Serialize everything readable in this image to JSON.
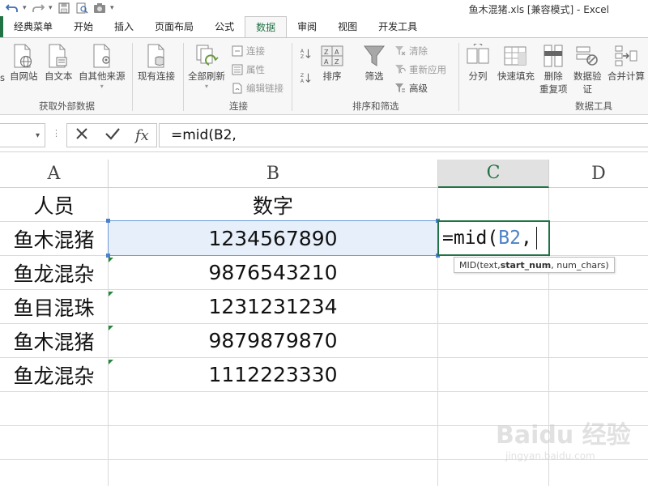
{
  "window": {
    "title": "鱼木混猪.xls  [兼容模式] - Excel"
  },
  "ribbon": {
    "tabs": [
      "经典菜单",
      "开始",
      "插入",
      "页面布局",
      "公式",
      "数据",
      "审阅",
      "视图",
      "开发工具"
    ],
    "active_tab": "数据",
    "groups": {
      "external": {
        "label": "获取外部数据",
        "cut_label": "s",
        "from_web": "自网站",
        "from_text": "自文本",
        "from_other": "自其他来源",
        "existing": "现有连接"
      },
      "connections": {
        "label": "连接",
        "refresh_all": "全部刷新",
        "connections": "连接",
        "properties": "属性",
        "edit_links": "编辑链接"
      },
      "sort_filter": {
        "label": "排序和筛选",
        "sort": "排序",
        "filter": "筛选",
        "clear": "清除",
        "reapply": "重新应用",
        "advanced": "高级"
      },
      "data_tools": {
        "label": "数据工具",
        "text_to_columns": "分列",
        "flash_fill": "快速填充",
        "remove_dup_1": "删除",
        "remove_dup_2": "重复项",
        "validation_1": "数据验",
        "validation_2": "证",
        "consolidate": "合并计算"
      }
    }
  },
  "formula_bar": {
    "fx": "fx",
    "formula": "=mid(B2,"
  },
  "grid": {
    "columns": [
      "A",
      "B",
      "C",
      "D"
    ],
    "selected_column": "C",
    "header_row": {
      "a": "人员",
      "b": "数字"
    },
    "rows": [
      {
        "a": "鱼木混猪",
        "b": "1234567890"
      },
      {
        "a": "鱼龙混杂",
        "b": "9876543210"
      },
      {
        "a": "鱼目混珠",
        "b": "1231231234"
      },
      {
        "a": "鱼木混猪",
        "b": "9879879870"
      },
      {
        "a": "鱼龙混杂",
        "b": "1112223330"
      }
    ],
    "active_cell": {
      "prefix": "=mid(",
      "ref": "B2",
      "suffix": ","
    },
    "tooltip": {
      "fn": "MID(text, ",
      "bold_arg": "start_num",
      "rest": ", num_chars)"
    }
  },
  "watermark": {
    "logo": "Baidu 经验",
    "url": "jingyan.baidu.com"
  },
  "colors": {
    "accent": "#217346",
    "selection": "#e7effa",
    "selection_border": "#6b9bd8",
    "ref_blue": "#4e82c6"
  }
}
